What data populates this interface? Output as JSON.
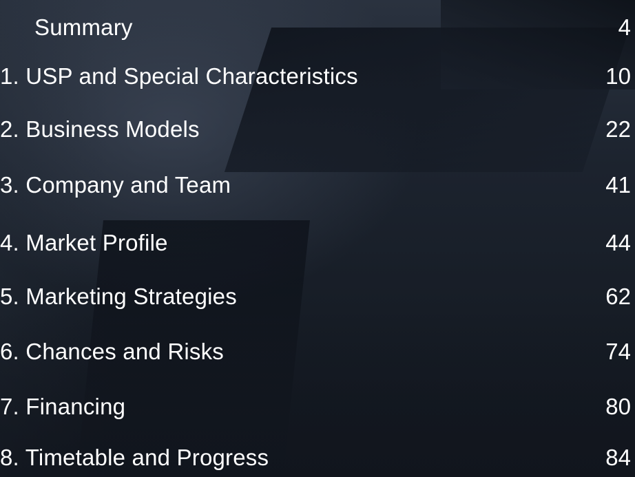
{
  "toc": {
    "entries": [
      {
        "title": "Summary",
        "page": "4"
      },
      {
        "title": "1. USP and Special Characteristics",
        "page": "10"
      },
      {
        "title": "2. Business Models",
        "page": "22"
      },
      {
        "title": "3. Company and Team",
        "page": "41"
      },
      {
        "title": "4. Market Profile",
        "page": "44"
      },
      {
        "title": "5. Marketing Strategies",
        "page": "62"
      },
      {
        "title": "6. Chances and Risks",
        "page": "74"
      },
      {
        "title": "7. Financing",
        "page": "80"
      },
      {
        "title": "8. Timetable and Progress",
        "page": "84"
      }
    ]
  }
}
